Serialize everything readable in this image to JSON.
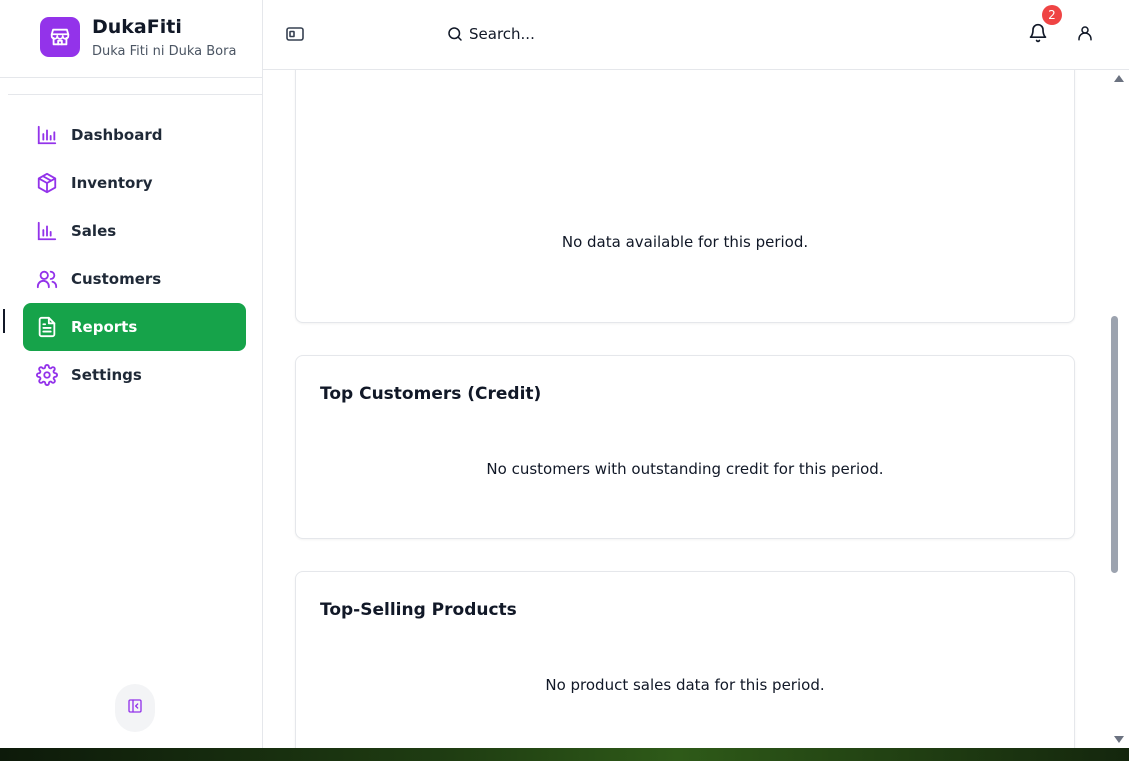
{
  "app": {
    "name": "DukaFiti",
    "tagline": "Duka Fiti ni Duka Bora"
  },
  "sidebar": {
    "items": [
      {
        "label": "Dashboard",
        "icon": "bar-chart-icon"
      },
      {
        "label": "Inventory",
        "icon": "package-icon"
      },
      {
        "label": "Sales",
        "icon": "bar-chart-icon"
      },
      {
        "label": "Customers",
        "icon": "users-icon"
      },
      {
        "label": "Reports",
        "icon": "file-text-icon",
        "active": true
      },
      {
        "label": "Settings",
        "icon": "gear-icon"
      }
    ],
    "collapse_icon": "panel-left-close-icon"
  },
  "header": {
    "search": {
      "placeholder": "Search..."
    },
    "notifications_count": "2"
  },
  "cards": [
    {
      "title": "",
      "message": "No data available for this period."
    },
    {
      "title": "Top Customers (Credit)",
      "message": "No customers with outstanding credit for this period."
    },
    {
      "title": "Top-Selling Products",
      "message": "No product sales data for this period."
    }
  ],
  "colors": {
    "brand_purple": "#9333ea",
    "active_green": "#16a34a",
    "badge_red": "#ef4444"
  }
}
